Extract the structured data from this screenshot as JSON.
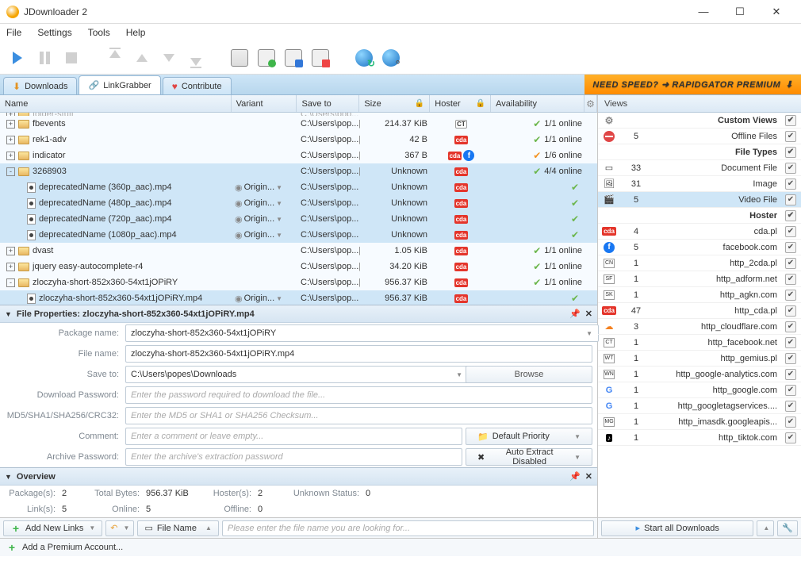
{
  "title": "JDownloader 2",
  "menu": {
    "file": "File",
    "settings": "Settings",
    "tools": "Tools",
    "help": "Help"
  },
  "tabs": {
    "downloads": "Downloads",
    "linkgrabber": "LinkGrabber",
    "contribute": "Contribute"
  },
  "promo": "NEED SPEED? ➜ RAPIDGATOR PREMIUM",
  "cols": {
    "name": "Name",
    "variant": "Variant",
    "save": "Save to",
    "size": "Size",
    "hoster": "Hoster",
    "avail": "Availability"
  },
  "rows": [
    {
      "t": "pkg",
      "exp": "+",
      "name": "fbevents",
      "save": "C:\\Users\\pop...",
      "cnt": "[1]",
      "size": "214.37 KiB",
      "host": "ct",
      "avail": "1/1 online",
      "chk": "g"
    },
    {
      "t": "pkg",
      "exp": "+",
      "name": "rek1-adv",
      "save": "C:\\Users\\pop...",
      "cnt": "[1]",
      "size": "42 B",
      "host": "cda",
      "avail": "1/1 online",
      "chk": "g"
    },
    {
      "t": "pkg",
      "exp": "+",
      "name": "indicator",
      "save": "C:\\Users\\pop...",
      "cnt": "[6]",
      "size": "367 B",
      "host": "cdafb",
      "avail": "1/6 online",
      "chk": "o"
    },
    {
      "t": "pkg",
      "exp": "-",
      "sel": true,
      "name": "3268903",
      "save": "C:\\Users\\pop...",
      "cnt": "[4]",
      "size": "Unknown",
      "host": "cda",
      "avail": "4/4 online",
      "chk": "g"
    },
    {
      "t": "file",
      "name": "deprecatedName (360p_aac).mp4",
      "var": "Origin...",
      "save": "C:\\Users\\pop...",
      "size": "Unknown",
      "host": "cda",
      "chk": "g"
    },
    {
      "t": "file",
      "name": "deprecatedName (480p_aac).mp4",
      "var": "Origin...",
      "save": "C:\\Users\\pop...",
      "size": "Unknown",
      "host": "cda",
      "chk": "g"
    },
    {
      "t": "file",
      "name": "deprecatedName (720p_aac).mp4",
      "var": "Origin...",
      "save": "C:\\Users\\pop...",
      "size": "Unknown",
      "host": "cda",
      "chk": "g"
    },
    {
      "t": "file",
      "name": "deprecatedName (1080p_aac).mp4",
      "var": "Origin...",
      "save": "C:\\Users\\pop...",
      "size": "Unknown",
      "host": "cda",
      "chk": "g"
    },
    {
      "t": "pkg",
      "exp": "+",
      "name": "dvast",
      "save": "C:\\Users\\pop...",
      "cnt": "[1]",
      "size": "1.05 KiB",
      "host": "cda",
      "avail": "1/1 online",
      "chk": "g"
    },
    {
      "t": "pkg",
      "exp": "+",
      "name": "jquery easy-autocomplete-r4",
      "save": "C:\\Users\\pop...",
      "cnt": "[1]",
      "size": "34.20 KiB",
      "host": "cda",
      "avail": "1/1 online",
      "chk": "g"
    },
    {
      "t": "pkg",
      "exp": "-",
      "name": "zloczyha-short-852x360-54xt1jOPiRY",
      "save": "C:\\Users\\pop...",
      "cnt": "[1]",
      "size": "956.37 KiB",
      "host": "cda",
      "avail": "1/1 online",
      "chk": "g"
    },
    {
      "t": "file",
      "name": "zloczyha-short-852x360-54xt1jOPiRY.mp4",
      "var": "Origin...",
      "save": "C:\\Users\\pop...",
      "size": "956.37 KiB",
      "host": "cda",
      "chk": "g"
    }
  ],
  "props": {
    "title": "File Properties: zloczyha-short-852x360-54xt1jOPiRY.mp4",
    "labels": {
      "pkg": "Package name:",
      "file": "File name:",
      "save": "Save to:",
      "pass": "Download Password:",
      "hash": "MD5/SHA1/SHA256/CRC32:",
      "comment": "Comment:",
      "arch": "Archive Password:"
    },
    "pkg": "zloczyha-short-852x360-54xt1jOPiRY",
    "file": "zloczyha-short-852x360-54xt1jOPiRY.mp4",
    "save": "C:\\Users\\popes\\Downloads",
    "browse": "Browse",
    "prio": "Default Priority",
    "extract": "Auto Extract Disabled",
    "ph": {
      "pass": "Enter the password required to download the file...",
      "hash": "Enter the MD5 or SHA1 or SHA256 Checksum...",
      "comment": "Enter a comment or leave empty...",
      "arch": "Enter the archive's extraction password"
    }
  },
  "ov": {
    "title": "Overview",
    "labels": {
      "pkgs": "Package(s):",
      "tb": "Total Bytes:",
      "hosters": "Hoster(s):",
      "unk": "Unknown Status:",
      "links": "Link(s):",
      "online": "Online:",
      "offline": "Offline:"
    },
    "pkgs": "2",
    "tb": "956.37 KiB",
    "hosters": "2",
    "unk": "0",
    "links": "5",
    "online": "5",
    "offline": "0"
  },
  "addlinks": "Add New Links",
  "filename": "File Name",
  "searchph": "Please enter the file name you are looking for...",
  "side": {
    "title": "Views",
    "items": [
      {
        "t": "hdr",
        "name": "Custom Views",
        "icon": "gear"
      },
      {
        "icon": "no",
        "count": "5",
        "name": "Offline Files"
      },
      {
        "t": "hdr",
        "name": "File Types"
      },
      {
        "icon": "doc",
        "count": "33",
        "name": "Document File"
      },
      {
        "icon": "img",
        "count": "31",
        "name": "Image"
      },
      {
        "icon": "vid",
        "count": "5",
        "name": "Video File",
        "sel": true
      },
      {
        "t": "hdr",
        "name": "Hoster"
      },
      {
        "icon": "cda",
        "count": "4",
        "name": "cda.pl"
      },
      {
        "icon": "fb",
        "count": "5",
        "name": "facebook.com"
      },
      {
        "icon": "CN",
        "count": "1",
        "name": "http_2cda.pl"
      },
      {
        "icon": "SF",
        "count": "1",
        "name": "http_adform.net"
      },
      {
        "icon": "SK",
        "count": "1",
        "name": "http_agkn.com"
      },
      {
        "icon": "cda",
        "count": "47",
        "name": "http_cda.pl"
      },
      {
        "icon": "cf",
        "count": "3",
        "name": "http_cloudflare.com"
      },
      {
        "icon": "CT",
        "count": "1",
        "name": "http_facebook.net"
      },
      {
        "icon": "WT",
        "count": "1",
        "name": "http_gemius.pl"
      },
      {
        "icon": "WN",
        "count": "1",
        "name": "http_google-analytics.com"
      },
      {
        "icon": "G",
        "count": "1",
        "name": "http_google.com"
      },
      {
        "icon": "G",
        "count": "1",
        "name": "http_googletagservices...."
      },
      {
        "icon": "MG",
        "count": "1",
        "name": "http_imasdk.googleapis..."
      },
      {
        "icon": "tk",
        "count": "1",
        "name": "http_tiktok.com"
      }
    ]
  },
  "startall": "Start all Downloads",
  "addprem": "Add a Premium Account..."
}
